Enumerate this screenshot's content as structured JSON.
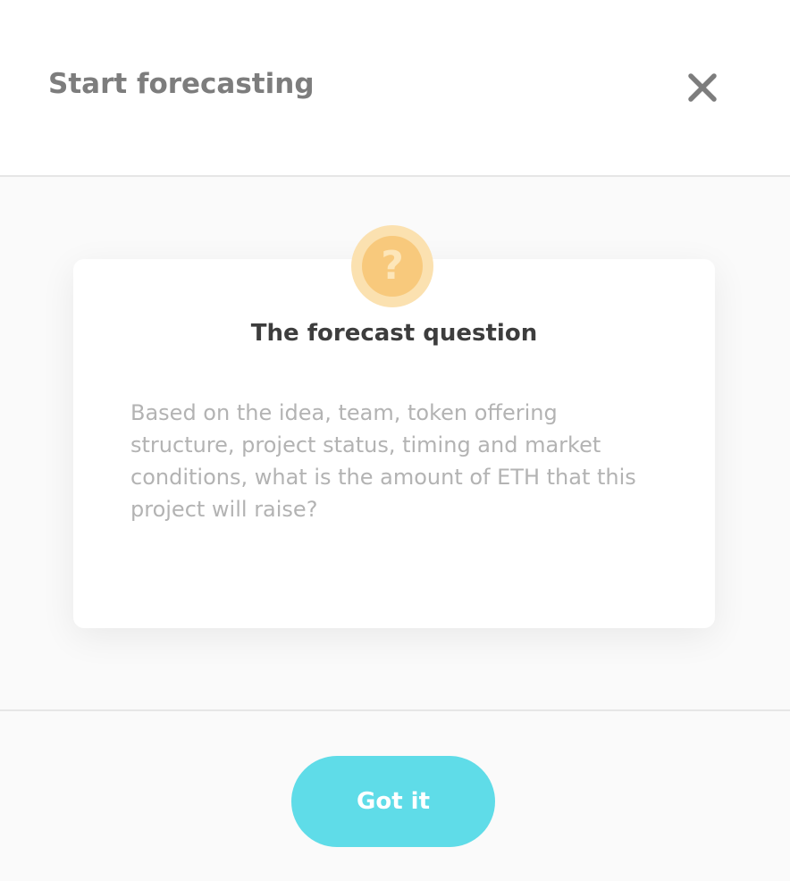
{
  "modal": {
    "title": "Start forecasting",
    "close_icon": "close-icon"
  },
  "card": {
    "icon": "question-icon",
    "icon_glyph": "?",
    "title": "The forecast question",
    "text": "Based on the idea, team, token offering structure, project status, timing and market conditions, what is the amount of ETH that this project will raise?"
  },
  "footer": {
    "confirm_label": "Got it"
  },
  "colors": {
    "accent": "#5fdce8",
    "icon_outer": "#fbe1b0",
    "icon_inner": "#f8c97c",
    "title_text": "#7d7d7d",
    "body_text": "#b3b3b3"
  }
}
